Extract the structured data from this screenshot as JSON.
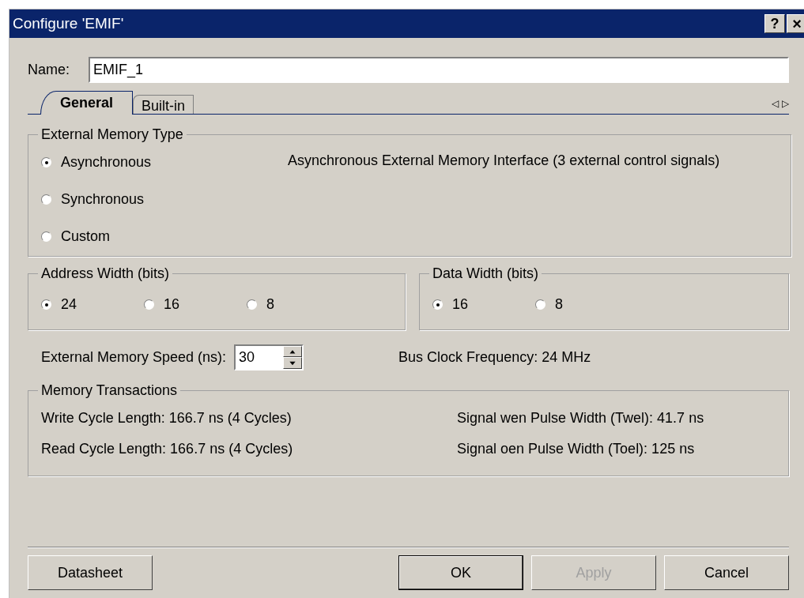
{
  "window": {
    "title": "Configure 'EMIF'",
    "help": "?",
    "close": "×"
  },
  "name_field": {
    "label": "Name:",
    "value": "EMIF_1"
  },
  "tabs": [
    {
      "label": "General",
      "selected": true
    },
    {
      "label": "Built-in",
      "selected": false
    }
  ],
  "tab_scroll": {
    "left": "◁",
    "right": "▷"
  },
  "memory_type": {
    "title": "External Memory Type",
    "options": [
      {
        "label": "Asynchronous",
        "selected": true
      },
      {
        "label": "Synchronous",
        "selected": false
      },
      {
        "label": "Custom",
        "selected": false
      }
    ],
    "description": "Asynchronous External Memory Interface (3 external control signals)"
  },
  "address_width": {
    "title": "Address Width (bits)",
    "options": [
      {
        "label": "24",
        "selected": true
      },
      {
        "label": "16",
        "selected": false
      },
      {
        "label": "8",
        "selected": false
      }
    ]
  },
  "data_width": {
    "title": "Data Width (bits)",
    "options": [
      {
        "label": "16",
        "selected": true
      },
      {
        "label": "8",
        "selected": false
      }
    ]
  },
  "speed": {
    "label": "External Memory Speed (ns):",
    "value": "30"
  },
  "bus_clock": "Bus Clock Frequency:  24 MHz",
  "transactions": {
    "title": "Memory Transactions",
    "rows": [
      {
        "left": "Write Cycle Length:  166.7 ns (4 Cycles)",
        "right": "Signal wen Pulse Width (Twel):  41.7 ns"
      },
      {
        "left": "Read Cycle Length:  166.7 ns (4 Cycles)",
        "right": "Signal oen Pulse Width (Toel):  125 ns"
      }
    ]
  },
  "buttons": [
    {
      "label": "Datasheet",
      "disabled": false,
      "default": false
    },
    {
      "label": "OK",
      "disabled": false,
      "default": true
    },
    {
      "label": "Apply",
      "disabled": true,
      "default": false
    },
    {
      "label": "Cancel",
      "disabled": false,
      "default": false
    }
  ]
}
